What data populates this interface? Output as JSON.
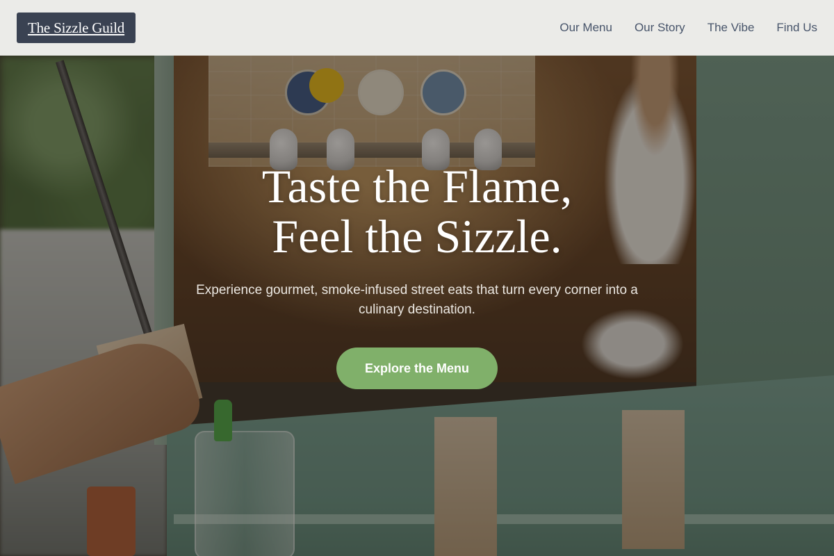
{
  "brand": {
    "name": "The Sizzle Guild",
    "bg_color": "#3a4252"
  },
  "nav": {
    "items": [
      {
        "label": "Our Menu"
      },
      {
        "label": "Our Story"
      },
      {
        "label": "The Vibe"
      },
      {
        "label": "Find Us"
      }
    ]
  },
  "hero": {
    "title_line1": "Taste the Flame,",
    "title_line2": "Feel the Sizzle.",
    "subtitle": "Experience gourmet, smoke-infused street eats that turn every corner into a culinary destination.",
    "cta_label": "Explore the Menu",
    "cta_color": "#80b06a"
  }
}
